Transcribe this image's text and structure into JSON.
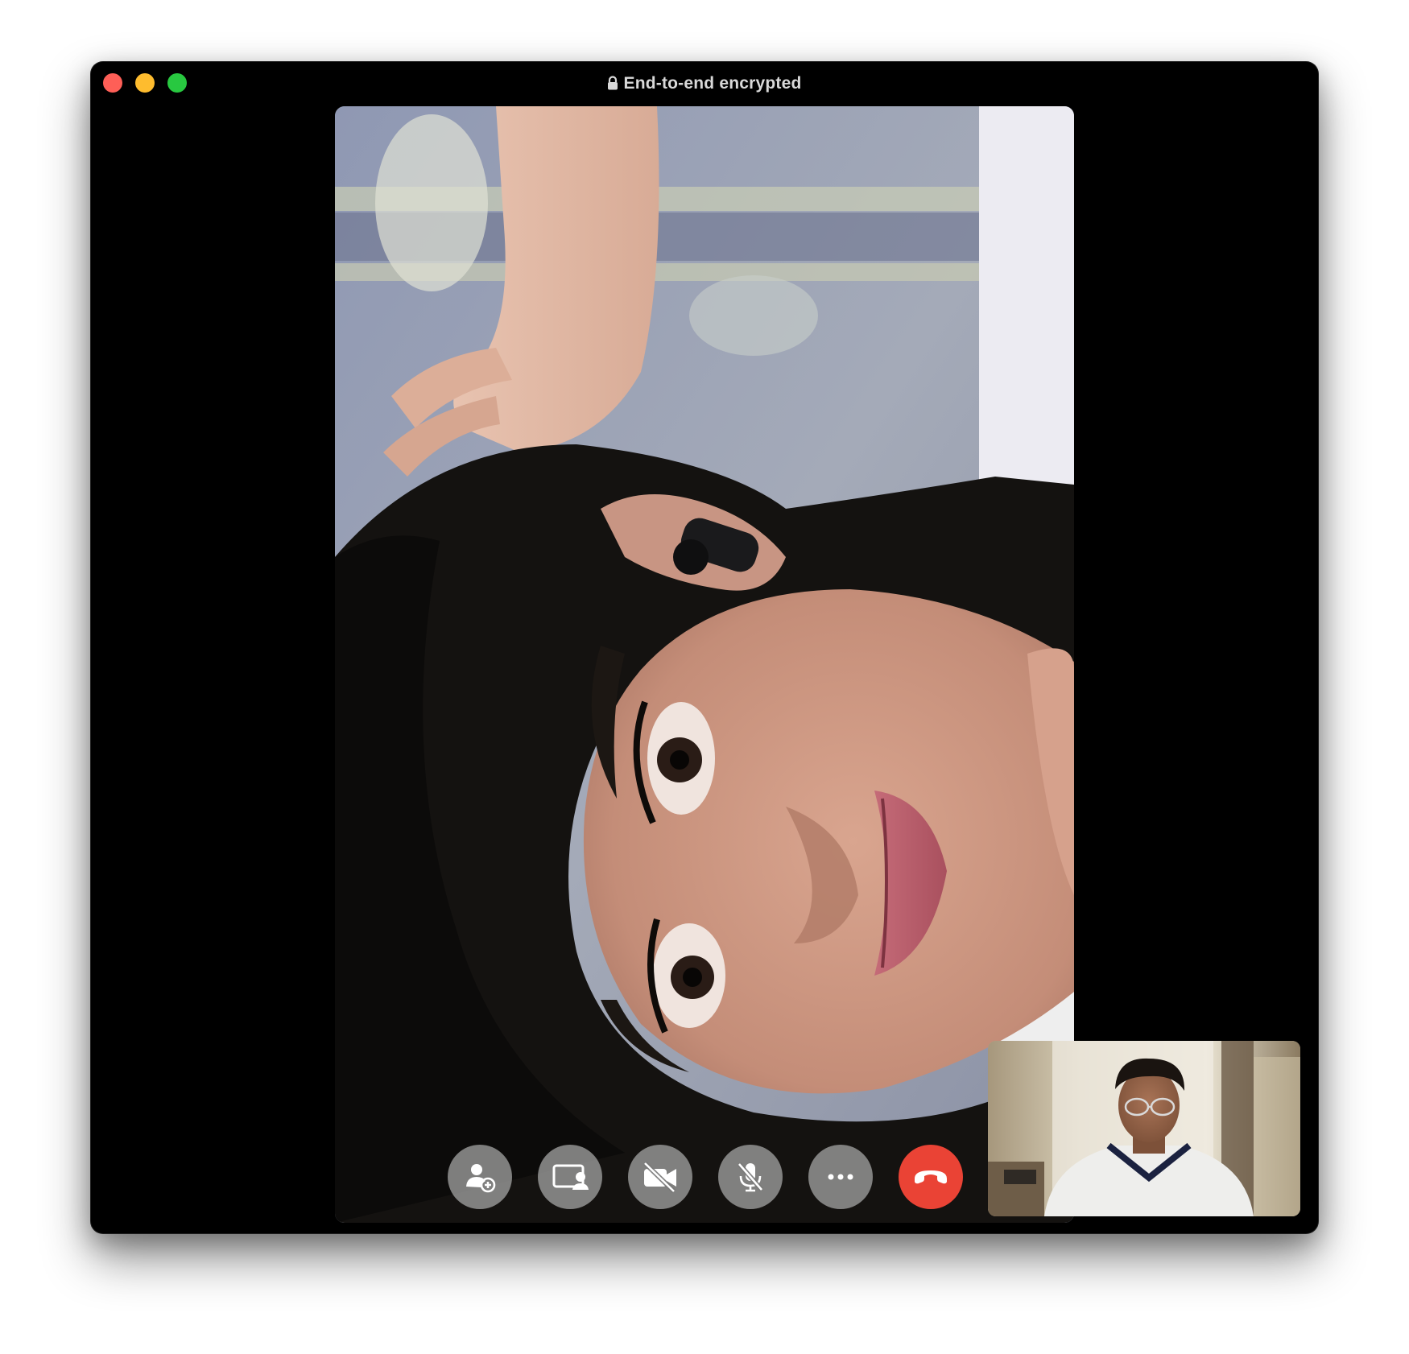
{
  "window": {
    "title": "End-to-end encrypted",
    "title_icon": "lock-icon",
    "traffic_lights": [
      "close",
      "minimize",
      "zoom"
    ]
  },
  "call": {
    "remote_video": "remote-participant-video",
    "self_video": "self-preview-video"
  },
  "controls": [
    {
      "name": "add-person-button",
      "icon": "person-plus-icon"
    },
    {
      "name": "share-screen-button",
      "icon": "screen-share-icon"
    },
    {
      "name": "camera-off-button",
      "icon": "video-slash-icon"
    },
    {
      "name": "microphone-off-button",
      "icon": "mic-slash-icon"
    },
    {
      "name": "more-options-button",
      "icon": "ellipsis-icon"
    },
    {
      "name": "end-call-button",
      "icon": "phone-down-icon"
    }
  ],
  "colors": {
    "close": "#fe5f57",
    "minimize": "#febc2e",
    "zoom": "#28c840",
    "end_call": "#ea4335",
    "window_bg": "#000000"
  }
}
